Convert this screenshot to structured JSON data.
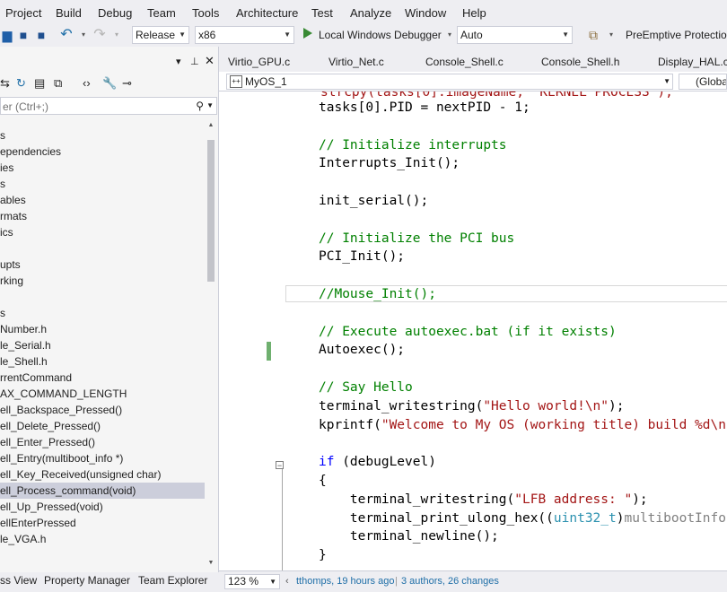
{
  "menu": [
    "Project",
    "Build",
    "Debug",
    "Team",
    "Tools",
    "Architecture",
    "Test",
    "Analyze",
    "Window",
    "Help"
  ],
  "toolbar": {
    "configuration": "Release",
    "platform": "x86",
    "debugger": "Local Windows Debugger",
    "debug_mode": "Auto",
    "extension": "PreEmptive Protection"
  },
  "solution_explorer": {
    "search_placeholder": "er (Ctrl+;)",
    "tree": [
      "s",
      "ependencies",
      "ies",
      "s",
      "ables",
      "rmats",
      "ics",
      "",
      "upts",
      "rking",
      "",
      "s",
      "Number.h",
      "le_Serial.h",
      "le_Shell.h",
      "rrentCommand",
      "AX_COMMAND_LENGTH",
      "ell_Backspace_Pressed()",
      "ell_Delete_Pressed()",
      "ell_Enter_Pressed()",
      "ell_Entry(multiboot_info *)",
      "ell_Key_Received(unsigned char)",
      "ell_Process_command(void)",
      "ell_Up_Pressed(void)",
      "ellEnterPressed",
      "le_VGA.h"
    ],
    "selected_index": 22,
    "bottom_tabs": [
      "ss View",
      "Property Manager",
      "Team Explorer"
    ]
  },
  "doc_tabs": [
    "Virtio_GPU.c",
    "Virtio_Net.c",
    "Console_Shell.c",
    "Console_Shell.h",
    "Display_HAL.c"
  ],
  "nav": {
    "project": "MyOS_1",
    "scope": "(Globa"
  },
  "code": [
    "tasks[0].PID = nextPID - 1;",
    "",
    "// Initialize interrupts",
    "Interrupts_Init();",
    "",
    "init_serial();",
    "",
    "// Initialize the PCI bus",
    "PCI_Init();",
    "",
    "//Mouse_Init();",
    "",
    "// Execute autoexec.bat (if it exists)",
    "Autoexec();",
    "",
    "// Say Hello",
    "terminal_writestring(\"Hello world!\\n\");",
    "kprintf(\"Welcome to My OS (working title) build %d\\n",
    "",
    "if (debugLevel)",
    "{",
    "    terminal_writestring(\"LFB address: \");",
    "    terminal_print_ulong_hex((uint32_t)multibootInfo",
    "    terminal_newline();",
    "}"
  ],
  "status": {
    "zoom": "123 %",
    "author_info": "tthomps, 19 hours ago",
    "changes": "3 authors, 26 changes"
  }
}
